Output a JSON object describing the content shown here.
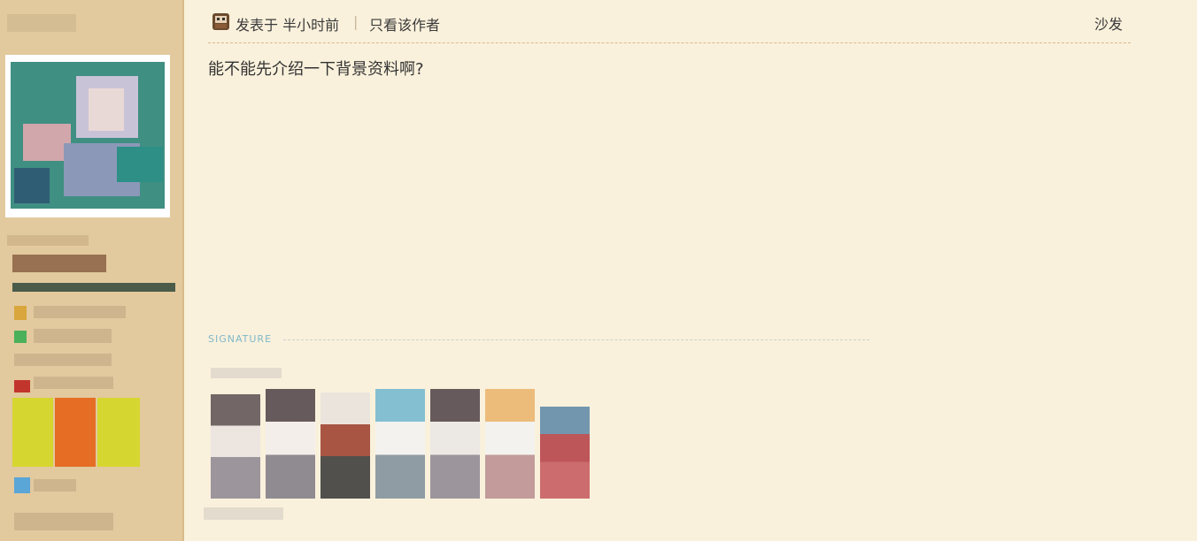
{
  "post": {
    "posted_prefix": "发表于 半小时前",
    "separator": "|",
    "only_author_link": "只看该作者",
    "floor_label": "沙发",
    "content": "能不能先介绍一下背景资料啊?"
  },
  "signature": {
    "label": "SIGNATURE"
  },
  "icons": {
    "author": "author-avatar-icon"
  },
  "colors": {
    "page_bg": "#faf1dc",
    "sidebar_bg": "#e2c99e",
    "signature_accent": "#7fb8c9",
    "divider": "#d9b98c"
  }
}
